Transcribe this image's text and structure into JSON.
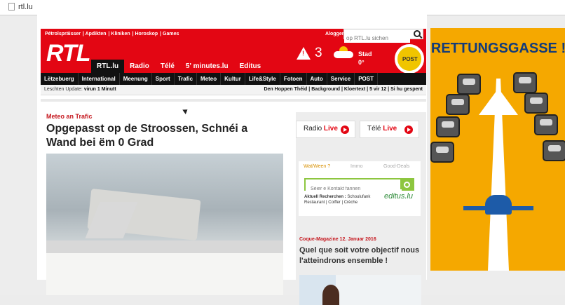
{
  "browser": {
    "address": "rtl.lu"
  },
  "header": {
    "top_links": [
      "Pétrolspräisser",
      "Apdikten",
      "Kliniken",
      "Horoskop",
      "Games"
    ],
    "login": "Aloggen",
    "search_placeholder": "op RTL.lu sichen",
    "logo": "RTL",
    "channels": [
      "RTL.lu",
      "Radio",
      "Télé",
      "5' minutes.lu",
      "Editus"
    ],
    "warning_count": "3",
    "weather_label": "Stad",
    "temperature": "0°",
    "post_logo": "POST"
  },
  "nav": [
    "Lëtzebuerg",
    "International",
    "Meenung",
    "Sport",
    "Trafic",
    "Meteo",
    "Kultur",
    "Life&Style",
    "Fotoen",
    "Auto",
    "Service",
    "POST"
  ],
  "status": {
    "update_label": "Leschten Update:",
    "update_value": "virun 1 Minutt",
    "breaking": [
      "Den Hoppen Théid",
      "Background",
      "Kloertext",
      "5 vir 12",
      "Si hu gespent"
    ]
  },
  "article": {
    "kicker": "Meteo an Trafic",
    "title": "Opgepasst op de Stroossen, Schnéi a Wand bei ëm 0 Grad"
  },
  "side": {
    "radio_label": "Radio",
    "radio_live": "Live",
    "tele_label": "Télé",
    "tele_live": "Live",
    "tabs": [
      "Wat/Ween ?",
      "Immo",
      "Good-Deals"
    ],
    "search_placeholder": "Séier e Kontakt fannen",
    "recent_label": "Aktuell Recherchen :",
    "recent_text": "Schoulufank Restaurant | Coiffer | Crèche",
    "editus": "editus.lu",
    "coque_kicker": "Coque-Magazine 12. Januar 2016",
    "coque_title": "Quel que soit votre objectif nous l'atteindrons ensemble !"
  },
  "ad": {
    "title": "RETTUNGSGASSE !"
  }
}
